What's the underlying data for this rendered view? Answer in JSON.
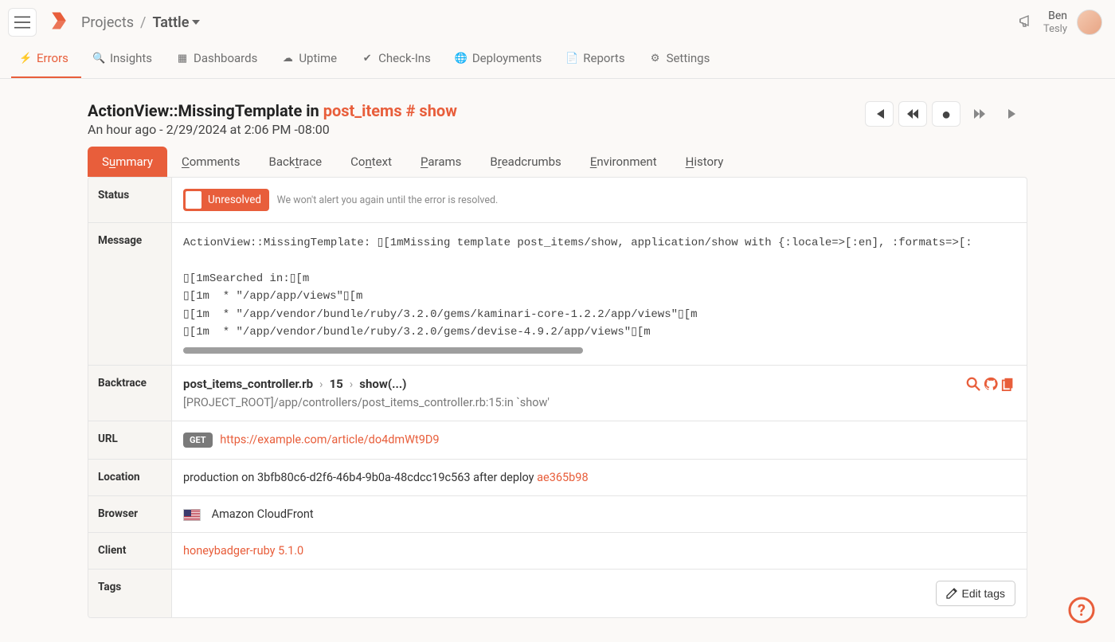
{
  "header": {
    "breadcrumb_root": "Projects",
    "breadcrumb_current": "Tattle",
    "user_first": "Ben",
    "user_last": "Tesly"
  },
  "mainnav": {
    "errors": "Errors",
    "insights": "Insights",
    "dashboards": "Dashboards",
    "uptime": "Uptime",
    "checkins": "Check-Ins",
    "deployments": "Deployments",
    "reports": "Reports",
    "settings": "Settings"
  },
  "error": {
    "class": "ActionView::MissingTemplate",
    "in": " in ",
    "where": "post_items # show",
    "time": "An hour ago - 2/29/2024 at 2:06 PM -08:00"
  },
  "subtabs": {
    "summary": {
      "pre": "S",
      "u": "u",
      "post": "mmary"
    },
    "comments": {
      "u": "C",
      "post": "omments"
    },
    "backtrace": {
      "pre": "Back",
      "u": "t",
      "post": "race"
    },
    "context": {
      "pre": "Co",
      "u": "n",
      "post": "text"
    },
    "params": {
      "u": "P",
      "post": "arams"
    },
    "breadcrumbs": {
      "pre": "B",
      "u": "r",
      "post": "eadcrumbs"
    },
    "environment": {
      "u": "E",
      "post": "nvironment"
    },
    "history": {
      "u": "H",
      "post": "istory"
    }
  },
  "rows": {
    "status_label": "Status",
    "status_value": "Unresolved",
    "status_note": "We won't alert you again until the error is resolved.",
    "message_label": "Message",
    "message_text": "ActionView::MissingTemplate: ▯[1mMissing template post_items/show, application/show with {:locale=>[:en], :formats=>[:\n\n▯[1mSearched in:▯[m\n▯[1m  * \"/app/app/views\"▯[m\n▯[1m  * \"/app/vendor/bundle/ruby/3.2.0/gems/kaminari-core-1.2.2/app/views\"▯[m\n▯[1m  * \"/app/vendor/bundle/ruby/3.2.0/gems/devise-4.9.2/app/views\"▯[m",
    "backtrace_label": "Backtrace",
    "backtrace_file": "post_items_controller.rb",
    "backtrace_line": "15",
    "backtrace_method": "show(...)",
    "backtrace_sub": "[PROJECT_ROOT]/app/controllers/post_items_controller.rb:15:in `show'",
    "url_label": "URL",
    "url_method": "GET",
    "url_value": "https://example.com/article/do4dmWt9D9",
    "location_label": "Location",
    "location_pre": "production on 3bfb80c6-d2f6-46b4-9b0a-48cdcc19c563 after deploy ",
    "location_link": "ae365b98",
    "browser_label": "Browser",
    "browser_value": "Amazon CloudFront",
    "client_label": "Client",
    "client_value": "honeybadger-ruby 5.1.0",
    "tags_label": "Tags",
    "edit_tags": "Edit tags"
  }
}
